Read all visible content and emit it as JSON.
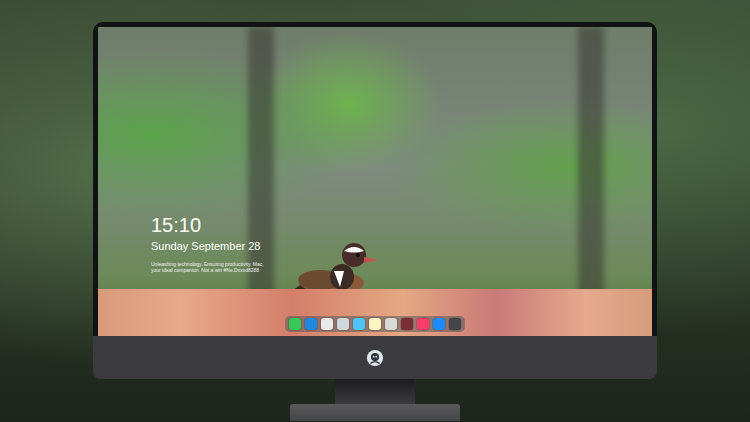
{
  "lock_screen": {
    "time": "15:10",
    "date": "Sunday September 28",
    "caption": [
      "Unleashing technology, Ensuring productivity. Mac,",
      "your ideal companion. Not a win #Ne.Dxxxd8288"
    ]
  },
  "dock": {
    "items": [
      {
        "color": "#34c759"
      },
      {
        "color": "#1e88e5"
      },
      {
        "color": "#e9e9e9"
      },
      {
        "color": "#cfd8dc"
      },
      {
        "color": "#4fc3f7"
      },
      {
        "color": "#fff3c4"
      },
      {
        "color": "#d9d9d9"
      },
      {
        "color": "#7a2d33"
      },
      {
        "color": "#fc3c6a"
      },
      {
        "color": "#1a8cff"
      },
      {
        "color": "#444448"
      }
    ]
  }
}
